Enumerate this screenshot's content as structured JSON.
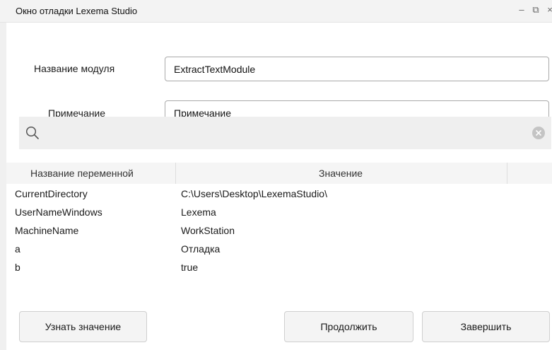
{
  "window": {
    "title": "Окно отладки Lexema Studio",
    "minimize_glyph": "–",
    "restore_glyph": "⧉",
    "close_glyph": "×"
  },
  "form": {
    "module_label": "Название модуля",
    "module_value": "ExtractTextModule",
    "note_label": "Примечание",
    "note_value": "Примечание"
  },
  "search": {
    "icon": "search-icon",
    "clear_icon": "clear-icon",
    "value": ""
  },
  "table": {
    "columns": [
      "Название переменной",
      "Значение"
    ],
    "rows": [
      [
        "CurrentDirectory",
        "C:\\Users\\Desktop\\LexemaStudio\\"
      ],
      [
        "UserNameWindows",
        "Lexema"
      ],
      [
        "MachineName",
        "WorkStation"
      ],
      [
        "a",
        "Отладка"
      ],
      [
        "b",
        "true"
      ]
    ]
  },
  "buttons": {
    "get_value": "Узнать значение",
    "continue": "Продолжить",
    "finish": "Завершить"
  }
}
